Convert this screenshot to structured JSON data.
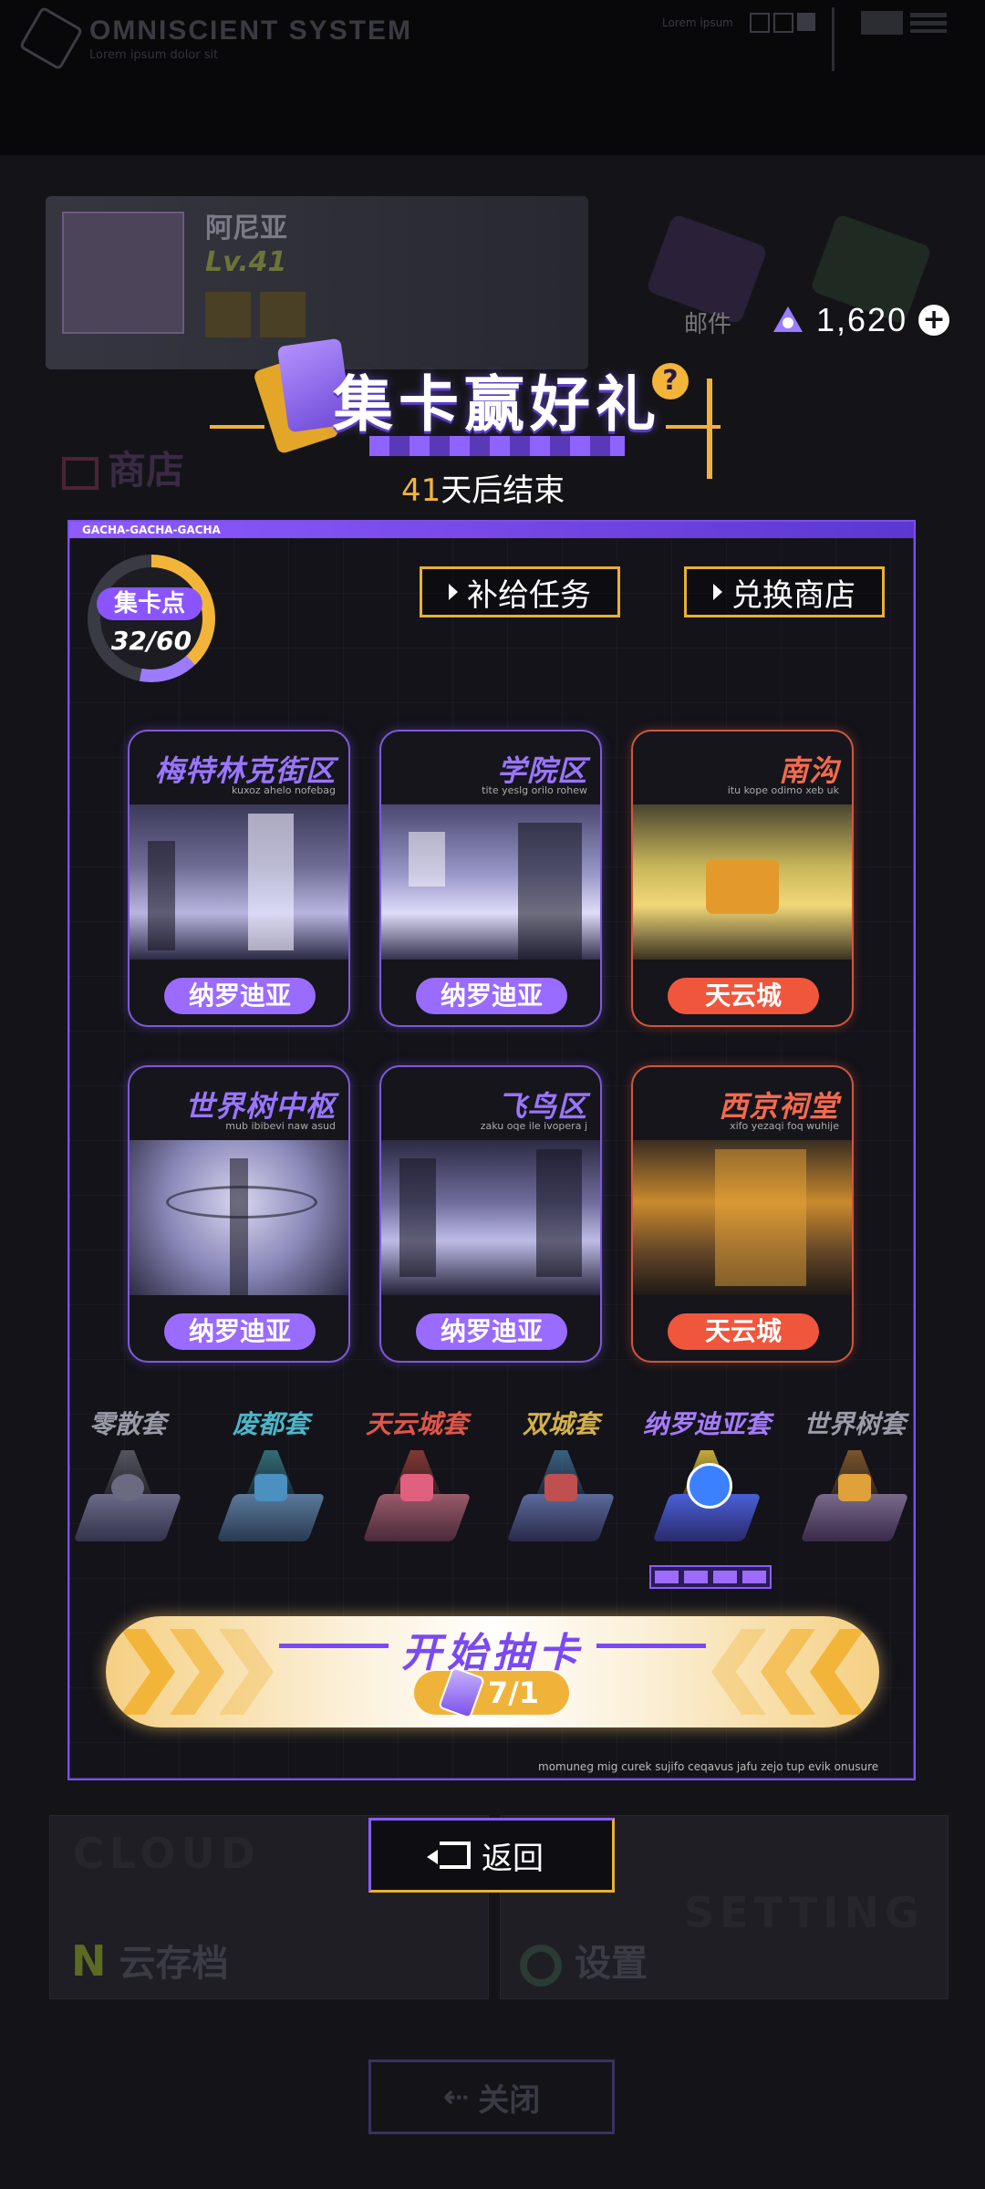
{
  "header": {
    "logo_title": "OMNISCIENT SYSTEM",
    "logo_subtitle": "Lorem ipsum dolor sit",
    "top_right_label": "Lorem ipsum"
  },
  "background": {
    "player_name": "阿尼亚",
    "player_level": "Lv.41",
    "shop_label": "商店",
    "mail_label": "邮件",
    "cloud_label": "云存档",
    "cloud_en": "CLOUD",
    "setting_label": "设置",
    "setting_en": "SETTING",
    "close_label": "关闭"
  },
  "currency": {
    "value": "1,620",
    "icon": "crystal-icon"
  },
  "event": {
    "title": "集卡赢好礼",
    "countdown_days": "41",
    "countdown_suffix": "天后结束"
  },
  "panel": {
    "header_label": "GACHA-GACHA-GACHA",
    "points_label": "集卡点",
    "points_value": "32/60",
    "supply_quest_button": "补给任务",
    "exchange_shop_button": "兑换商店",
    "footer_text": "momuneg mig curek sujifo ceqavus jafu zejo tup evik onusure"
  },
  "districts": [
    {
      "name": "梅特林克街区",
      "sub": "kuxoz ahelo nofebag",
      "tag": "纳罗迪亚",
      "region": "naro"
    },
    {
      "name": "学院区",
      "sub": "tite yeslg orilo rohew",
      "tag": "纳罗迪亚",
      "region": "naro"
    },
    {
      "name": "南沟",
      "sub": "itu kope odimo xeb uk",
      "tag": "天云城",
      "region": "tianyun"
    },
    {
      "name": "世界树中枢",
      "sub": "mub ibibevi naw asud",
      "tag": "纳罗迪亚",
      "region": "naro"
    },
    {
      "name": "飞鸟区",
      "sub": "zaku oqe ile ivopera j",
      "tag": "纳罗迪亚",
      "region": "naro"
    },
    {
      "name": "西京祠堂",
      "sub": "xifo yezaqi foq wuhije",
      "tag": "天云城",
      "region": "tianyun"
    }
  ],
  "sets": [
    {
      "label": "零散套",
      "color": "#8a8a99"
    },
    {
      "label": "废都套",
      "color": "#4db6c8"
    },
    {
      "label": "天云城套",
      "color": "#e0564a"
    },
    {
      "label": "双城套",
      "color": "#d4b04a"
    },
    {
      "label": "纳罗迪亚套",
      "color": "#a77bff"
    },
    {
      "label": "世界树套",
      "color": "#8a8a99"
    }
  ],
  "selected_set_progress": {
    "filled": 4,
    "total": 4
  },
  "draw": {
    "label": "开始抽卡",
    "cost": "7/1",
    "icon": "ticket-icon"
  },
  "return_button": "返回",
  "colors": {
    "accent_purple": "#8a5cff",
    "accent_gold": "#f2b53a",
    "tianyun_red": "#f0563c"
  }
}
